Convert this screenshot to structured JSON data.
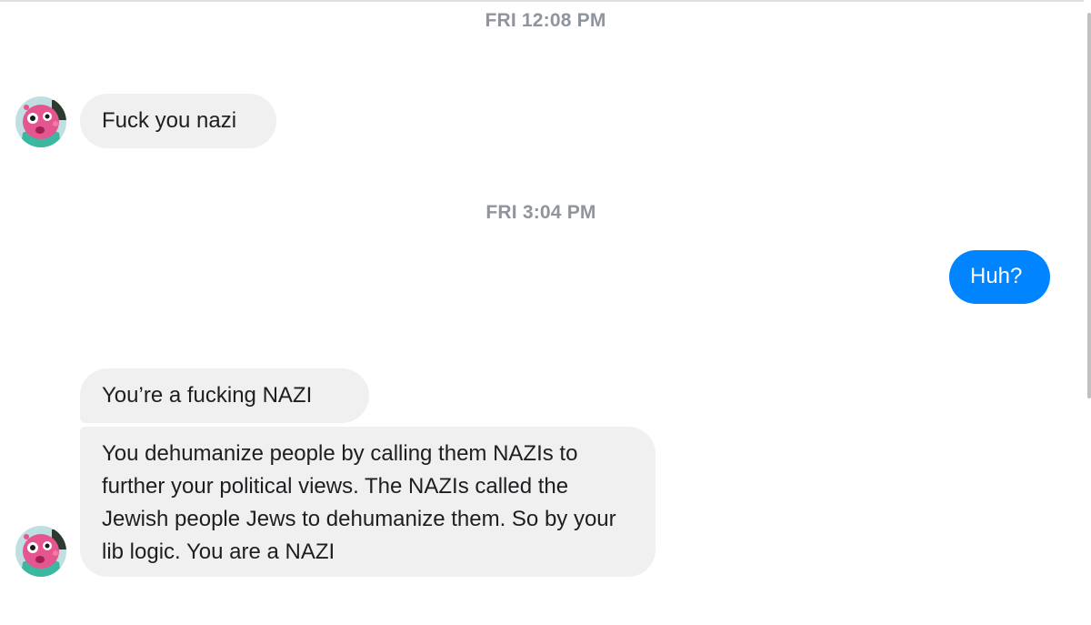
{
  "thread": {
    "messages_groups": [
      {
        "timestamp": "FRI 12:08 PM",
        "messages": [
          {
            "sender": "other",
            "text": "Fuck you nazi"
          }
        ]
      },
      {
        "timestamp": "FRI 3:04 PM",
        "messages": [
          {
            "sender": "me",
            "text": "Huh?"
          },
          {
            "sender": "other",
            "text": "You’re a fucking NAZI"
          },
          {
            "sender": "other",
            "text": "You dehumanize people by calling them NAZIs to further your political views. The NAZIs called the Jewish people Jews to dehumanize them. So by your lib logic. You are a NAZI"
          }
        ]
      }
    ]
  },
  "avatar_icon": "cartoon-pink-creature-avatar",
  "colors": {
    "outgoing_bubble": "#0084ff",
    "incoming_bubble": "#f1f0f0",
    "timestamp": "#90949c"
  }
}
